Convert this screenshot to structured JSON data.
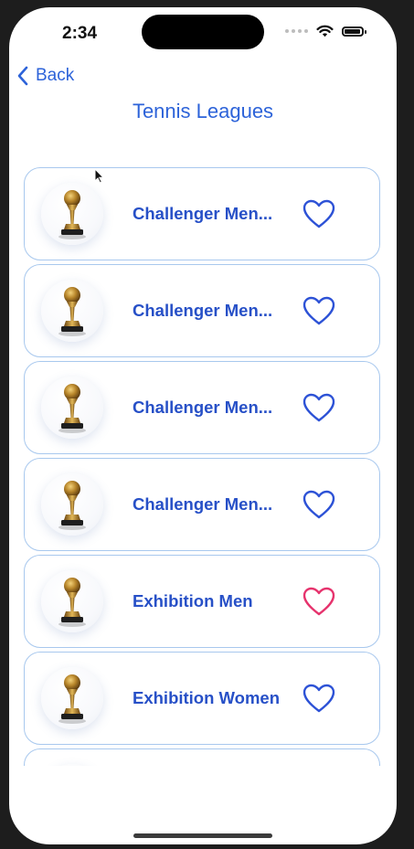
{
  "status_bar": {
    "time": "2:34"
  },
  "nav": {
    "back_label": "Back",
    "title": "Tennis Leagues"
  },
  "leagues": [
    {
      "name": "Challenger Men...",
      "favorited": false,
      "heart_color": "#2d52d6"
    },
    {
      "name": "Challenger Men...",
      "favorited": false,
      "heart_color": "#2d52d6"
    },
    {
      "name": "Challenger Men...",
      "favorited": false,
      "heart_color": "#2d52d6"
    },
    {
      "name": "Challenger Men...",
      "favorited": false,
      "heart_color": "#2d52d6"
    },
    {
      "name": "Exhibition Men",
      "favorited": true,
      "heart_color": "#e6336d"
    },
    {
      "name": "Exhibition Women",
      "favorited": false,
      "heart_color": "#2d52d6"
    },
    {
      "name": "",
      "favorited": false,
      "heart_color": "#2d52d6"
    }
  ],
  "colors": {
    "accent": "#2d63d9",
    "card_border": "#a8c8ee",
    "favorite_active": "#e6336d"
  },
  "icons": {
    "back": "chevron-left-icon",
    "favorite": "heart-icon",
    "league_logo": "trophy-icon"
  }
}
